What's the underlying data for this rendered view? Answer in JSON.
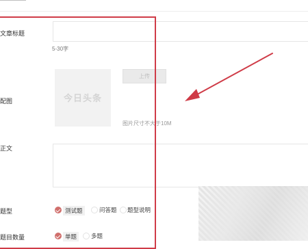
{
  "form": {
    "title_label": "文章标题",
    "title_value": "",
    "title_counter": "5-30字",
    "cover_label": "配图",
    "cover_watermark": "今日头条",
    "upload_label": "上传",
    "image_hint": "图片尺寸不大于10M",
    "body_label": "正文",
    "body_value": "",
    "type_label": "题型",
    "type_options": [
      {
        "label": "测试题",
        "checked": true
      },
      {
        "label": "问答题",
        "checked": false
      },
      {
        "label": "题型说明",
        "checked": false
      }
    ],
    "count_label": "题目数量",
    "count_options": [
      {
        "label": "单题",
        "checked": true
      },
      {
        "label": "多题",
        "checked": false
      }
    ]
  },
  "colors": {
    "highlight_red": "#cf3b47",
    "radio_checked": "#d06f6c"
  }
}
